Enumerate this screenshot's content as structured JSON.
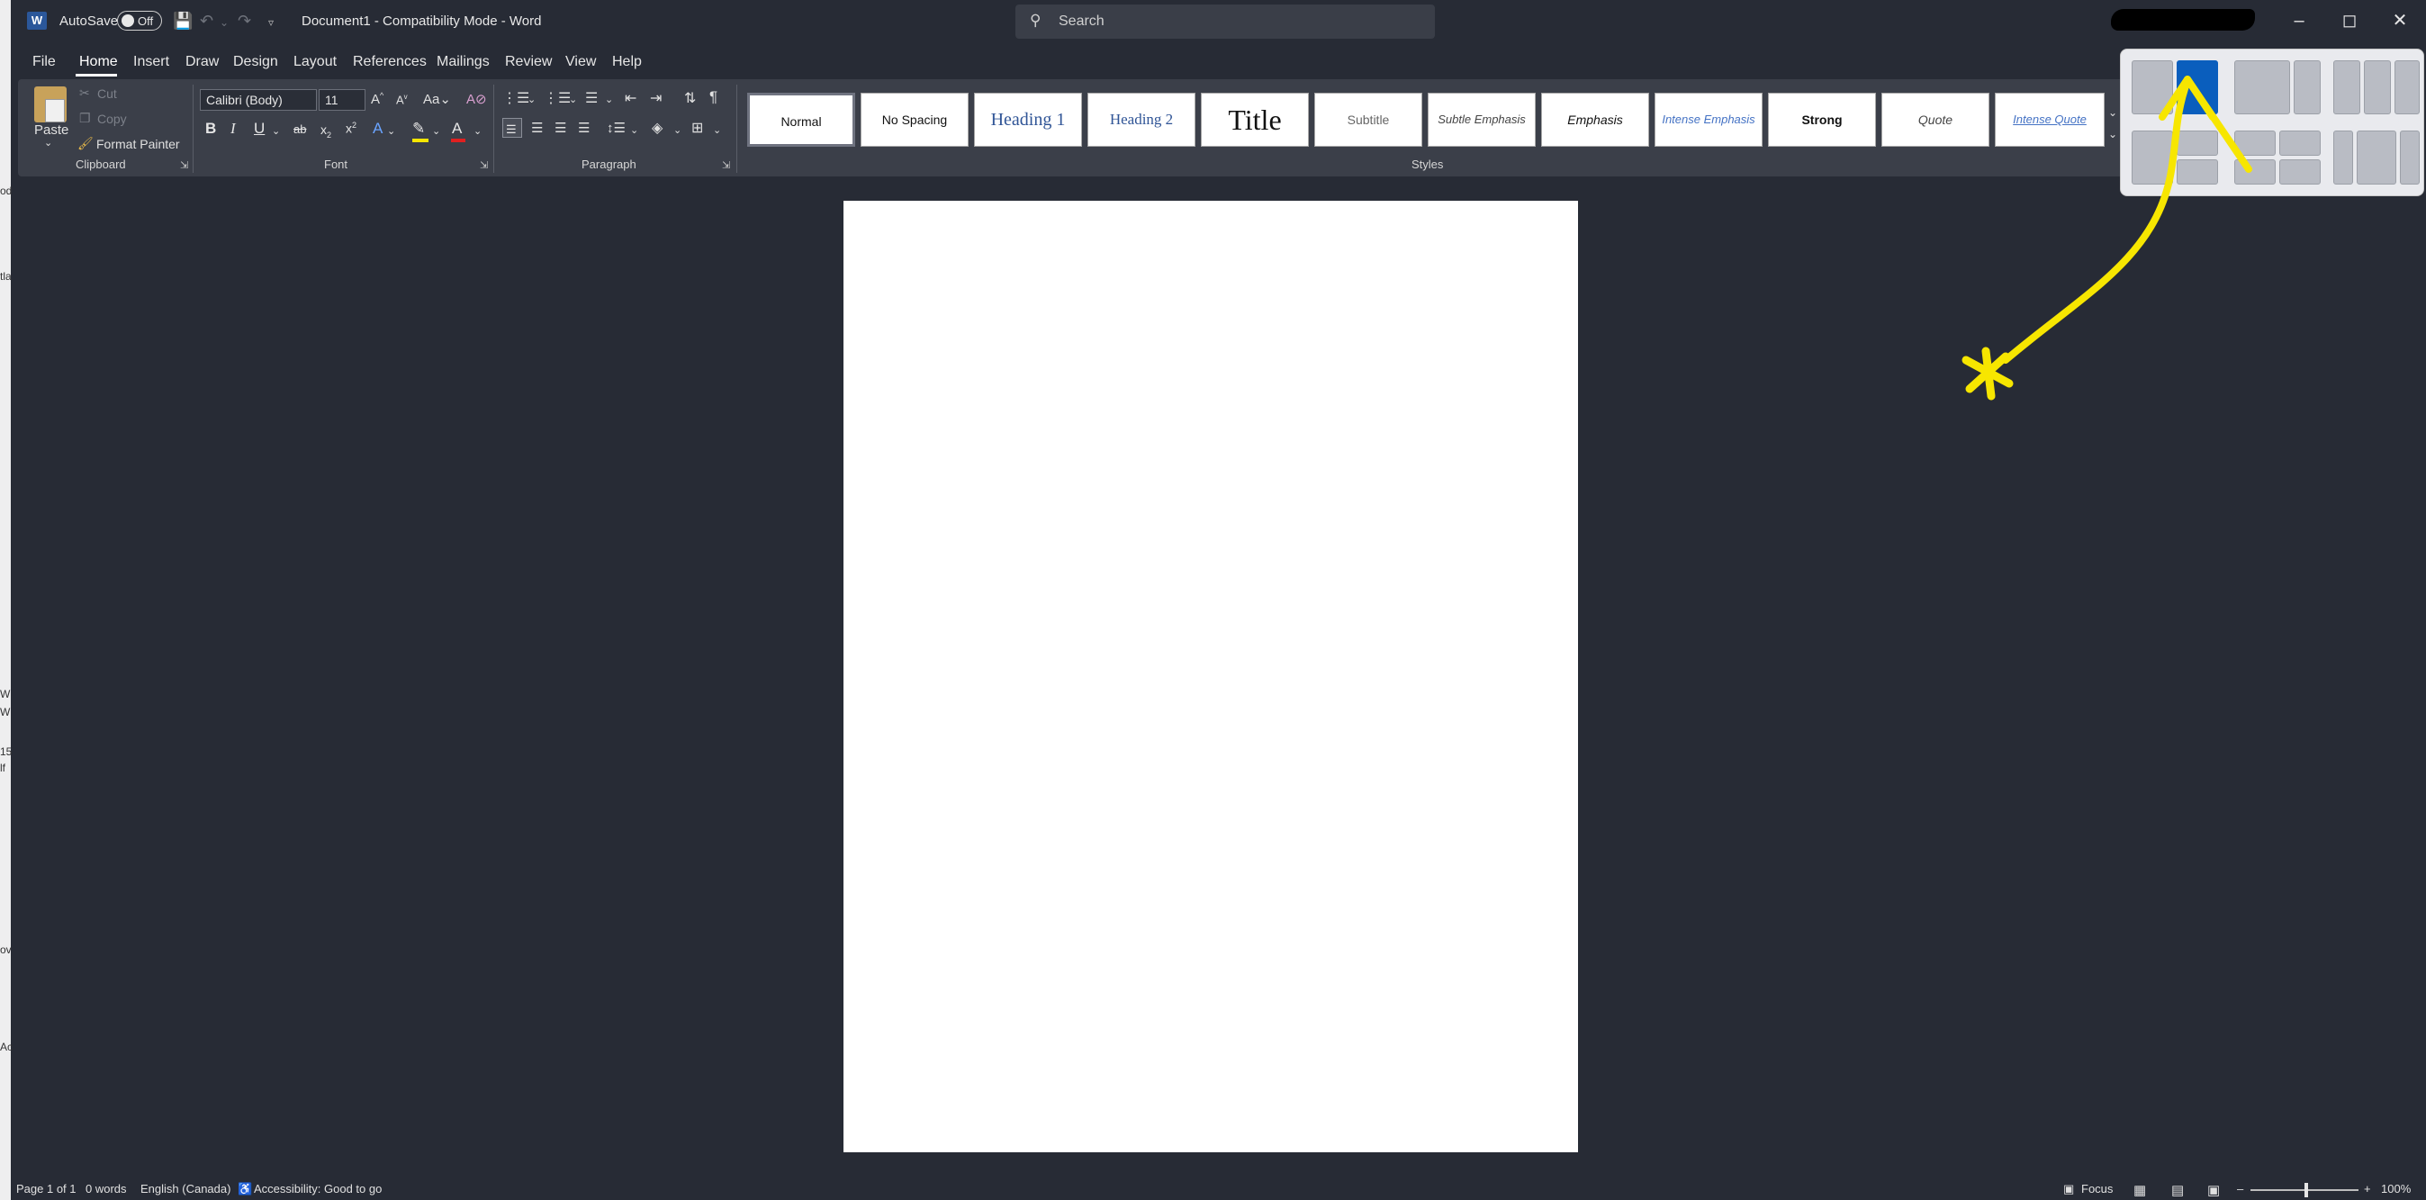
{
  "title_bar": {
    "app_icon": "W",
    "autosave_label": "AutoSave",
    "autosave_state": "Off",
    "document_title": "Document1  -  Compatibility Mode  -  Word",
    "search_placeholder": "Search"
  },
  "menu_tabs": [
    "File",
    "Home",
    "Insert",
    "Draw",
    "Design",
    "Layout",
    "References",
    "Mailings",
    "Review",
    "View",
    "Help"
  ],
  "active_tab": "Home",
  "clipboard": {
    "paste_label": "Paste",
    "cut_label": "Cut",
    "copy_label": "Copy",
    "format_painter_label": "Format Painter",
    "group_label": "Clipboard"
  },
  "font": {
    "font_name": "Calibri (Body)",
    "font_size": "11",
    "group_label": "Font"
  },
  "paragraph": {
    "group_label": "Paragraph"
  },
  "styles": {
    "group_label": "Styles",
    "items": [
      "Normal",
      "No Spacing",
      "Heading 1",
      "Heading 2",
      "Title",
      "Subtitle",
      "Subtle Emphasis",
      "Emphasis",
      "Intense Emphasis",
      "Strong",
      "Quote",
      "Intense Quote"
    ]
  },
  "left_strip_text": [
    "od",
    "tla",
    "W",
    "W",
    "15",
    "lf",
    "ov",
    "Ac"
  ],
  "status_bar": {
    "page": "Page 1 of 1",
    "words": "0 words",
    "language": "English (Canada)",
    "accessibility": "Accessibility: Good to go",
    "focus": "Focus",
    "zoom": "100%"
  },
  "colors": {
    "background": "#272b35",
    "ribbon": "#3b3f49",
    "accent": "#0a5ebd",
    "annotation": "#f7e600"
  }
}
